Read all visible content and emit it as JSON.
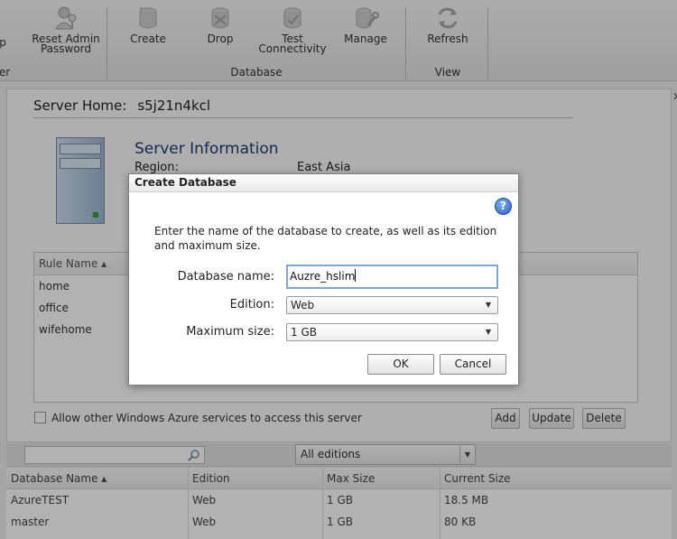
{
  "ribbon": {
    "partial_label": "p",
    "reset_admin_password": "Reset Admin Password",
    "reset_line1": "Reset Admin",
    "reset_line2": "Password",
    "create": "Create",
    "drop": "Drop",
    "test_line1": "Test",
    "test_line2": "Connectivity",
    "manage": "Manage",
    "refresh": "Refresh",
    "group_server_partial": "er",
    "group_database": "Database",
    "group_view": "View"
  },
  "server": {
    "home_label": "Server Home:",
    "home_value": "s5j21n4kcl",
    "info_title": "Server Information",
    "region_label": "Region:",
    "region_value": "East Asia"
  },
  "firewall": {
    "column_rule_name": "Rule Name ▴",
    "rules": [
      "home",
      "office",
      "wifehome"
    ],
    "allow_azure_label": "Allow other Windows Azure services to access this server",
    "add": "Add",
    "update": "Update",
    "delete": "Delete"
  },
  "databases": {
    "search_placeholder": "",
    "edition_filter": "All editions",
    "columns": [
      "Database Name ▴",
      "Edition",
      "Max Size",
      "Current Size"
    ],
    "rows": [
      [
        "AzureTEST",
        "Web",
        "1 GB",
        "18.5 MB"
      ],
      [
        "master",
        "Web",
        "1 GB",
        "80 KB"
      ]
    ]
  },
  "dialog": {
    "title": "Create Database",
    "help": "?",
    "description": "Enter the name of the database to create, as well as its edition and maximum size.",
    "name_label": "Database name:",
    "name_value": "Auzre_hslim",
    "edition_label": "Edition:",
    "edition_value": "Web",
    "max_size_label": "Maximum size:",
    "max_size_value": "1 GB",
    "ok": "OK",
    "cancel": "Cancel"
  },
  "colors": {
    "title_blue": "#1f3a74",
    "focus_border": "#7fa6d8",
    "help_blue": "#2a62c0"
  }
}
